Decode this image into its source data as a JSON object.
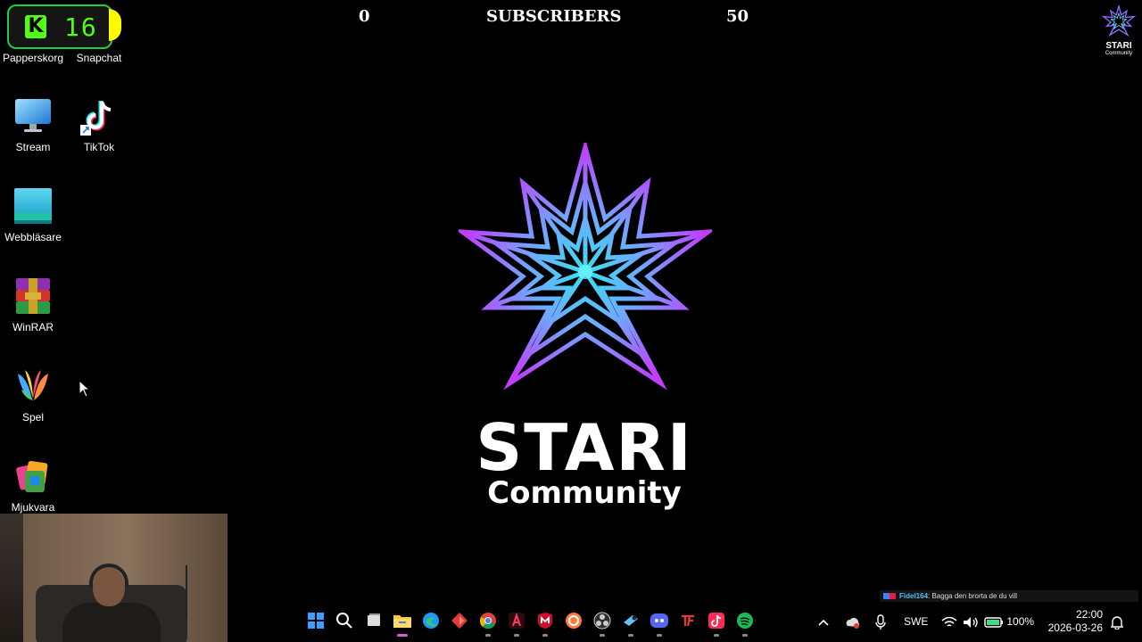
{
  "overlay": {
    "kick_count": "16",
    "sub_goal_current": "0",
    "sub_goal_label": "SUBSCRIBERS",
    "sub_goal_target": "50"
  },
  "desktop_icons": [
    {
      "label": "Papperskorg",
      "icon": "recycle-bin-icon"
    },
    {
      "label": "Snapchat",
      "icon": "snapchat-icon"
    },
    {
      "label": "Stream",
      "icon": "monitor-icon"
    },
    {
      "label": "TikTok",
      "icon": "tiktok-icon"
    },
    {
      "label": "Webbläsare",
      "icon": "browser-icon"
    },
    {
      "label": "WinRAR",
      "icon": "winrar-icon"
    },
    {
      "label": "Spel",
      "icon": "games-icon"
    },
    {
      "label": "Mjukvara",
      "icon": "software-icon"
    }
  ],
  "logo": {
    "title": "STARI",
    "subtitle": "Community",
    "corner_title": "STARI",
    "corner_sub": "Community"
  },
  "chat": {
    "user": "Fidel164",
    "message": ": Bagga den brorta de du vill"
  },
  "taskbar": {
    "apps": [
      {
        "name": "start-icon",
        "active": false,
        "running": false
      },
      {
        "name": "search-icon",
        "active": false,
        "running": false
      },
      {
        "name": "task-view-icon",
        "active": false,
        "running": false
      },
      {
        "name": "file-explorer-icon",
        "active": true,
        "running": true
      },
      {
        "name": "edge-icon",
        "active": false,
        "running": false
      },
      {
        "name": "red-diamond-app-icon",
        "active": false,
        "running": false
      },
      {
        "name": "chrome-icon",
        "active": false,
        "running": true
      },
      {
        "name": "adobe-icon",
        "active": false,
        "running": true
      },
      {
        "name": "mcafee-icon",
        "active": false,
        "running": true
      },
      {
        "name": "orange-circle-app-icon",
        "active": false,
        "running": false
      },
      {
        "name": "obs-icon",
        "active": false,
        "running": true
      },
      {
        "name": "steam-icon",
        "active": false,
        "running": true
      },
      {
        "name": "discord-icon",
        "active": false,
        "running": true
      },
      {
        "name": "tf-app-icon",
        "active": false,
        "running": false
      },
      {
        "name": "tiktok-live-icon",
        "active": false,
        "running": true
      },
      {
        "name": "spotify-icon",
        "active": false,
        "running": true
      }
    ],
    "tray": {
      "language": "SWE",
      "battery": "100%",
      "time": "22:00",
      "date": "2026-03-26"
    }
  },
  "colors": {
    "kick_green": "#53fc18",
    "star_purple": "#b83dff",
    "star_cyan": "#38e1f0",
    "active_indicator": "#e05bd0"
  }
}
